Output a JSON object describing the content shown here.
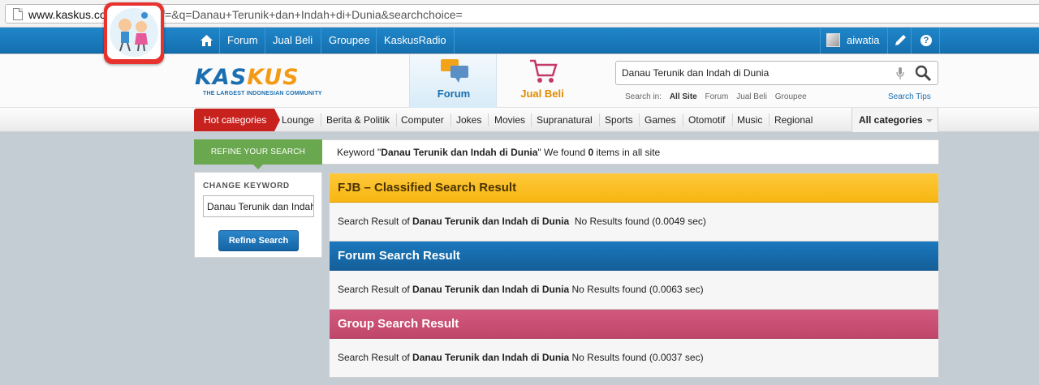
{
  "browser": {
    "url_domain": "www.kaskus.co.id",
    "url_rest": "/search?f=&q=Danau+Terunik+dan+Indah+di+Dunia&searchchoice="
  },
  "topnav": {
    "items": [
      "Forum",
      "Jual Beli",
      "Groupee",
      "KaskusRadio"
    ],
    "username": "aiwatia"
  },
  "header": {
    "logo_text_a": "KAS",
    "logo_text_b": "KUS",
    "logo_tagline": "THE LARGEST INDONESIAN COMMUNITY",
    "tab_forum": "Forum",
    "tab_jualbeli": "Jual Beli",
    "search_value": "Danau Terunik dan Indah di Dunia",
    "search_in_label": "Search in:",
    "search_in_options": [
      "All Site",
      "Forum",
      "Jual Beli",
      "Groupee"
    ],
    "search_tips": "Search Tips"
  },
  "categories": {
    "hot": "Hot categories",
    "items": [
      "Lounge",
      "Berita & Politik",
      "Computer",
      "Jokes",
      "Movies",
      "Supranatural",
      "Sports",
      "Games",
      "Otomotif",
      "Music",
      "Regional"
    ],
    "all": "All categories"
  },
  "refine": {
    "header": "REFINE YOUR SEARCH",
    "change_keyword": "CHANGE KEYWORD",
    "input_value": "Danau Terunik dan Indah di Dunia",
    "button": "Refine Search"
  },
  "summary": {
    "prefix": "Keyword \"",
    "keyword": "Danau Terunik dan Indah di Dunia",
    "middle": "\" We found ",
    "count": "0",
    "suffix": " items in all site"
  },
  "results": [
    {
      "title": "FJB – Classified Search Result",
      "prefix": "Search Result of ",
      "keyword": "Danau Terunik dan Indah di Dunia",
      "status": "  No Results found (0.0049 sec)"
    },
    {
      "title": "Forum Search Result",
      "prefix": "Search Result of ",
      "keyword": "Danau Terunik dan Indah di Dunia",
      "status": " No Results found (0.0063 sec)"
    },
    {
      "title": "Group Search Result",
      "prefix": "Search Result of ",
      "keyword": "Danau Terunik dan Indah di Dunia",
      "status": " No Results found (0.0037 sec)"
    }
  ],
  "colors": {
    "nav_blue": "#1570b0",
    "hot_red": "#c8221f",
    "refine_green": "#6aa84f",
    "fjb_yellow": "#f7b611",
    "forum_blue": "#145f99",
    "group_pink": "#c0456a"
  }
}
